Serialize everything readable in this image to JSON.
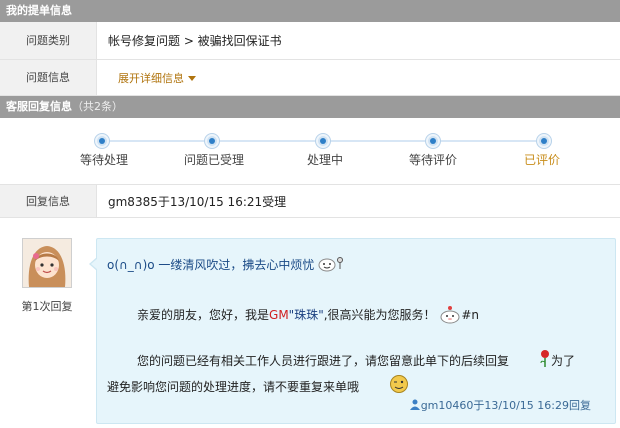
{
  "ticket_section": {
    "title": "我的提单信息",
    "rows": [
      {
        "label": "问题类别",
        "value": "帐号修复问题 > 被骗找回保证书"
      },
      {
        "label": "问题信息",
        "value": "展开详细信息"
      }
    ]
  },
  "service_section": {
    "title": "客服回复信息",
    "count_text": "（共2条）"
  },
  "progress": {
    "steps": [
      "等待处理",
      "问题已受理",
      "处理中",
      "等待评价",
      "已评价"
    ],
    "current_index": 4
  },
  "reply_info": {
    "label": "回复信息",
    "value": "gm8385于13/10/15 16:21受理"
  },
  "reply": {
    "avatar_label": "第1次回复",
    "greeting": "o(∩_∩)o 一缕清风吹过，拂去心中烦忧",
    "intro_prefix": "亲爱的朋友，您好，我是",
    "intro_gm": "GM",
    "intro_name": "\"珠珠\"",
    "intro_suffix": ",很高兴能为您服务！",
    "intro_tag": "#n",
    "body_part1": "您的问题已经有相关工作人员进行跟进了，请您留意此单下的后续回复",
    "body_part2": "为了避免影响您问题的处理进度，请不要重复来单哦",
    "footer": "gm10460于13/10/15 16:29回复"
  },
  "colors": {
    "header_bg": "#9b9b9b",
    "current_step": "#c88d1b",
    "bubble_bg": "#e6f5fb",
    "dot": "#2e7fc8"
  }
}
